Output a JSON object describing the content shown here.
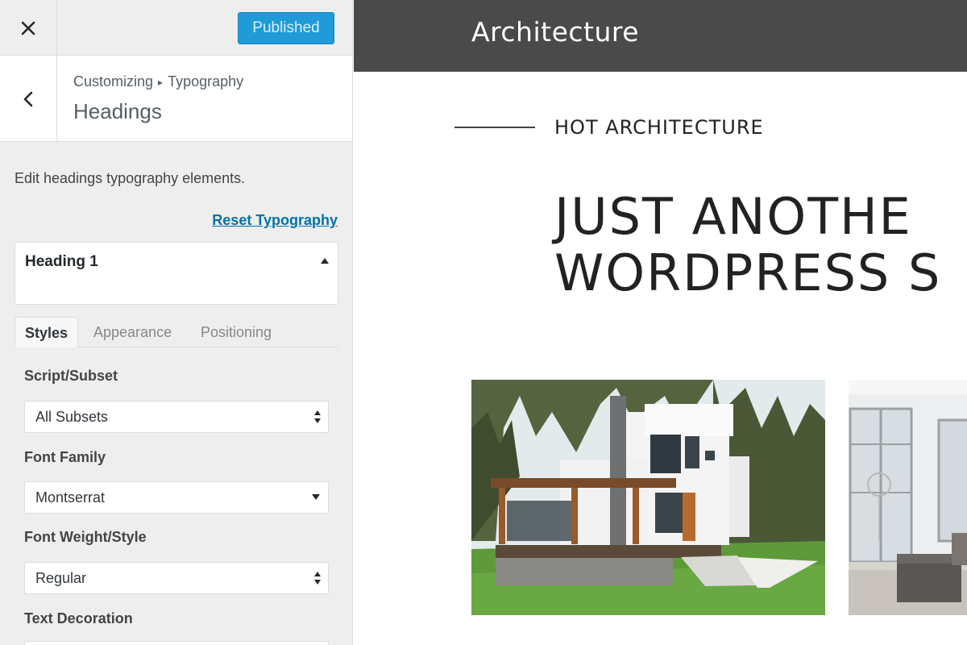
{
  "topbar": {
    "close_icon": "close-icon",
    "publish_label": "Published"
  },
  "section": {
    "breadcrumb_parent": "Customizing",
    "breadcrumb_separator": "▸",
    "breadcrumb_child": "Typography",
    "title": "Headings"
  },
  "panel": {
    "description": "Edit headings typography elements.",
    "reset_label": "Reset Typography",
    "accordion_title": "Heading 1",
    "tabs": [
      {
        "label": "Styles",
        "active": true
      },
      {
        "label": "Appearance",
        "active": false
      },
      {
        "label": "Positioning",
        "active": false
      }
    ],
    "fields": {
      "subset_label": "Script/Subset",
      "subset_value": "All Subsets",
      "font_family_label": "Font Family",
      "font_family_value": "Montserrat",
      "font_weight_label": "Font Weight/Style",
      "font_weight_value": "Regular",
      "text_decoration_label": "Text Decoration"
    }
  },
  "preview": {
    "site_title": "Architecture",
    "tagline": "HOT ARCHITECTURE",
    "hero_line1": "JUST ANOTHE",
    "hero_line2": "WORDPRESS S"
  },
  "colors": {
    "accent": "#1f9bd8",
    "link": "#0073aa",
    "header_bg": "#4a4a4a",
    "sidebar_bg": "#eeeeee"
  }
}
